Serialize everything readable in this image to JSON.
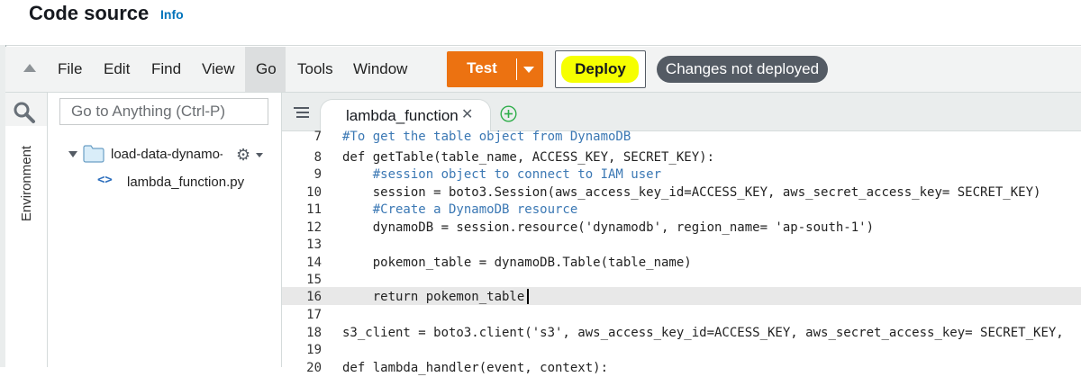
{
  "header": {
    "title": "Code source",
    "info_label": "Info"
  },
  "menu": {
    "items": [
      "File",
      "Edit",
      "Find",
      "View",
      "Go",
      "Tools",
      "Window"
    ],
    "active": "Go"
  },
  "toolbar": {
    "test_label": "Test",
    "deploy_label": "Deploy",
    "status_badge": "Changes not deployed",
    "accent_color": "#ec7211",
    "highlight_color": "#f6ff00"
  },
  "sidebar": {
    "environment_label": "Environment",
    "search_placeholder": "Go to Anything (Ctrl-P)",
    "folder_name": "load-data-dynamo-c",
    "file_name": "lambda_function.py"
  },
  "editor": {
    "tab_label": "lambda_function",
    "cursor_line": "16",
    "lines": [
      {
        "num": "7",
        "text": "#To get the table object from DynamoDB"
      },
      {
        "num": "8",
        "text": "def getTable(table_name, ACCESS_KEY, SECRET_KEY):"
      },
      {
        "num": "9",
        "text": "    #session object to connect to IAM user"
      },
      {
        "num": "10",
        "text": "    session = boto3.Session(aws_access_key_id=ACCESS_KEY, aws_secret_access_key= SECRET_KEY)"
      },
      {
        "num": "11",
        "text": "    #Create a DynamoDB resource"
      },
      {
        "num": "12",
        "text": "    dynamoDB = session.resource('dynamodb', region_name= 'ap-south-1')"
      },
      {
        "num": "13",
        "text": ""
      },
      {
        "num": "14",
        "text": "    pokemon_table = dynamoDB.Table(table_name)"
      },
      {
        "num": "15",
        "text": ""
      },
      {
        "num": "16",
        "text": "    return pokemon_table"
      },
      {
        "num": "17",
        "text": ""
      },
      {
        "num": "18",
        "text": "s3_client = boto3.client('s3', aws_access_key_id=ACCESS_KEY, aws_secret_access_key= SECRET_KEY,"
      },
      {
        "num": "19",
        "text": ""
      },
      {
        "num": "20",
        "text": "def lambda_handler(event, context):"
      }
    ]
  }
}
